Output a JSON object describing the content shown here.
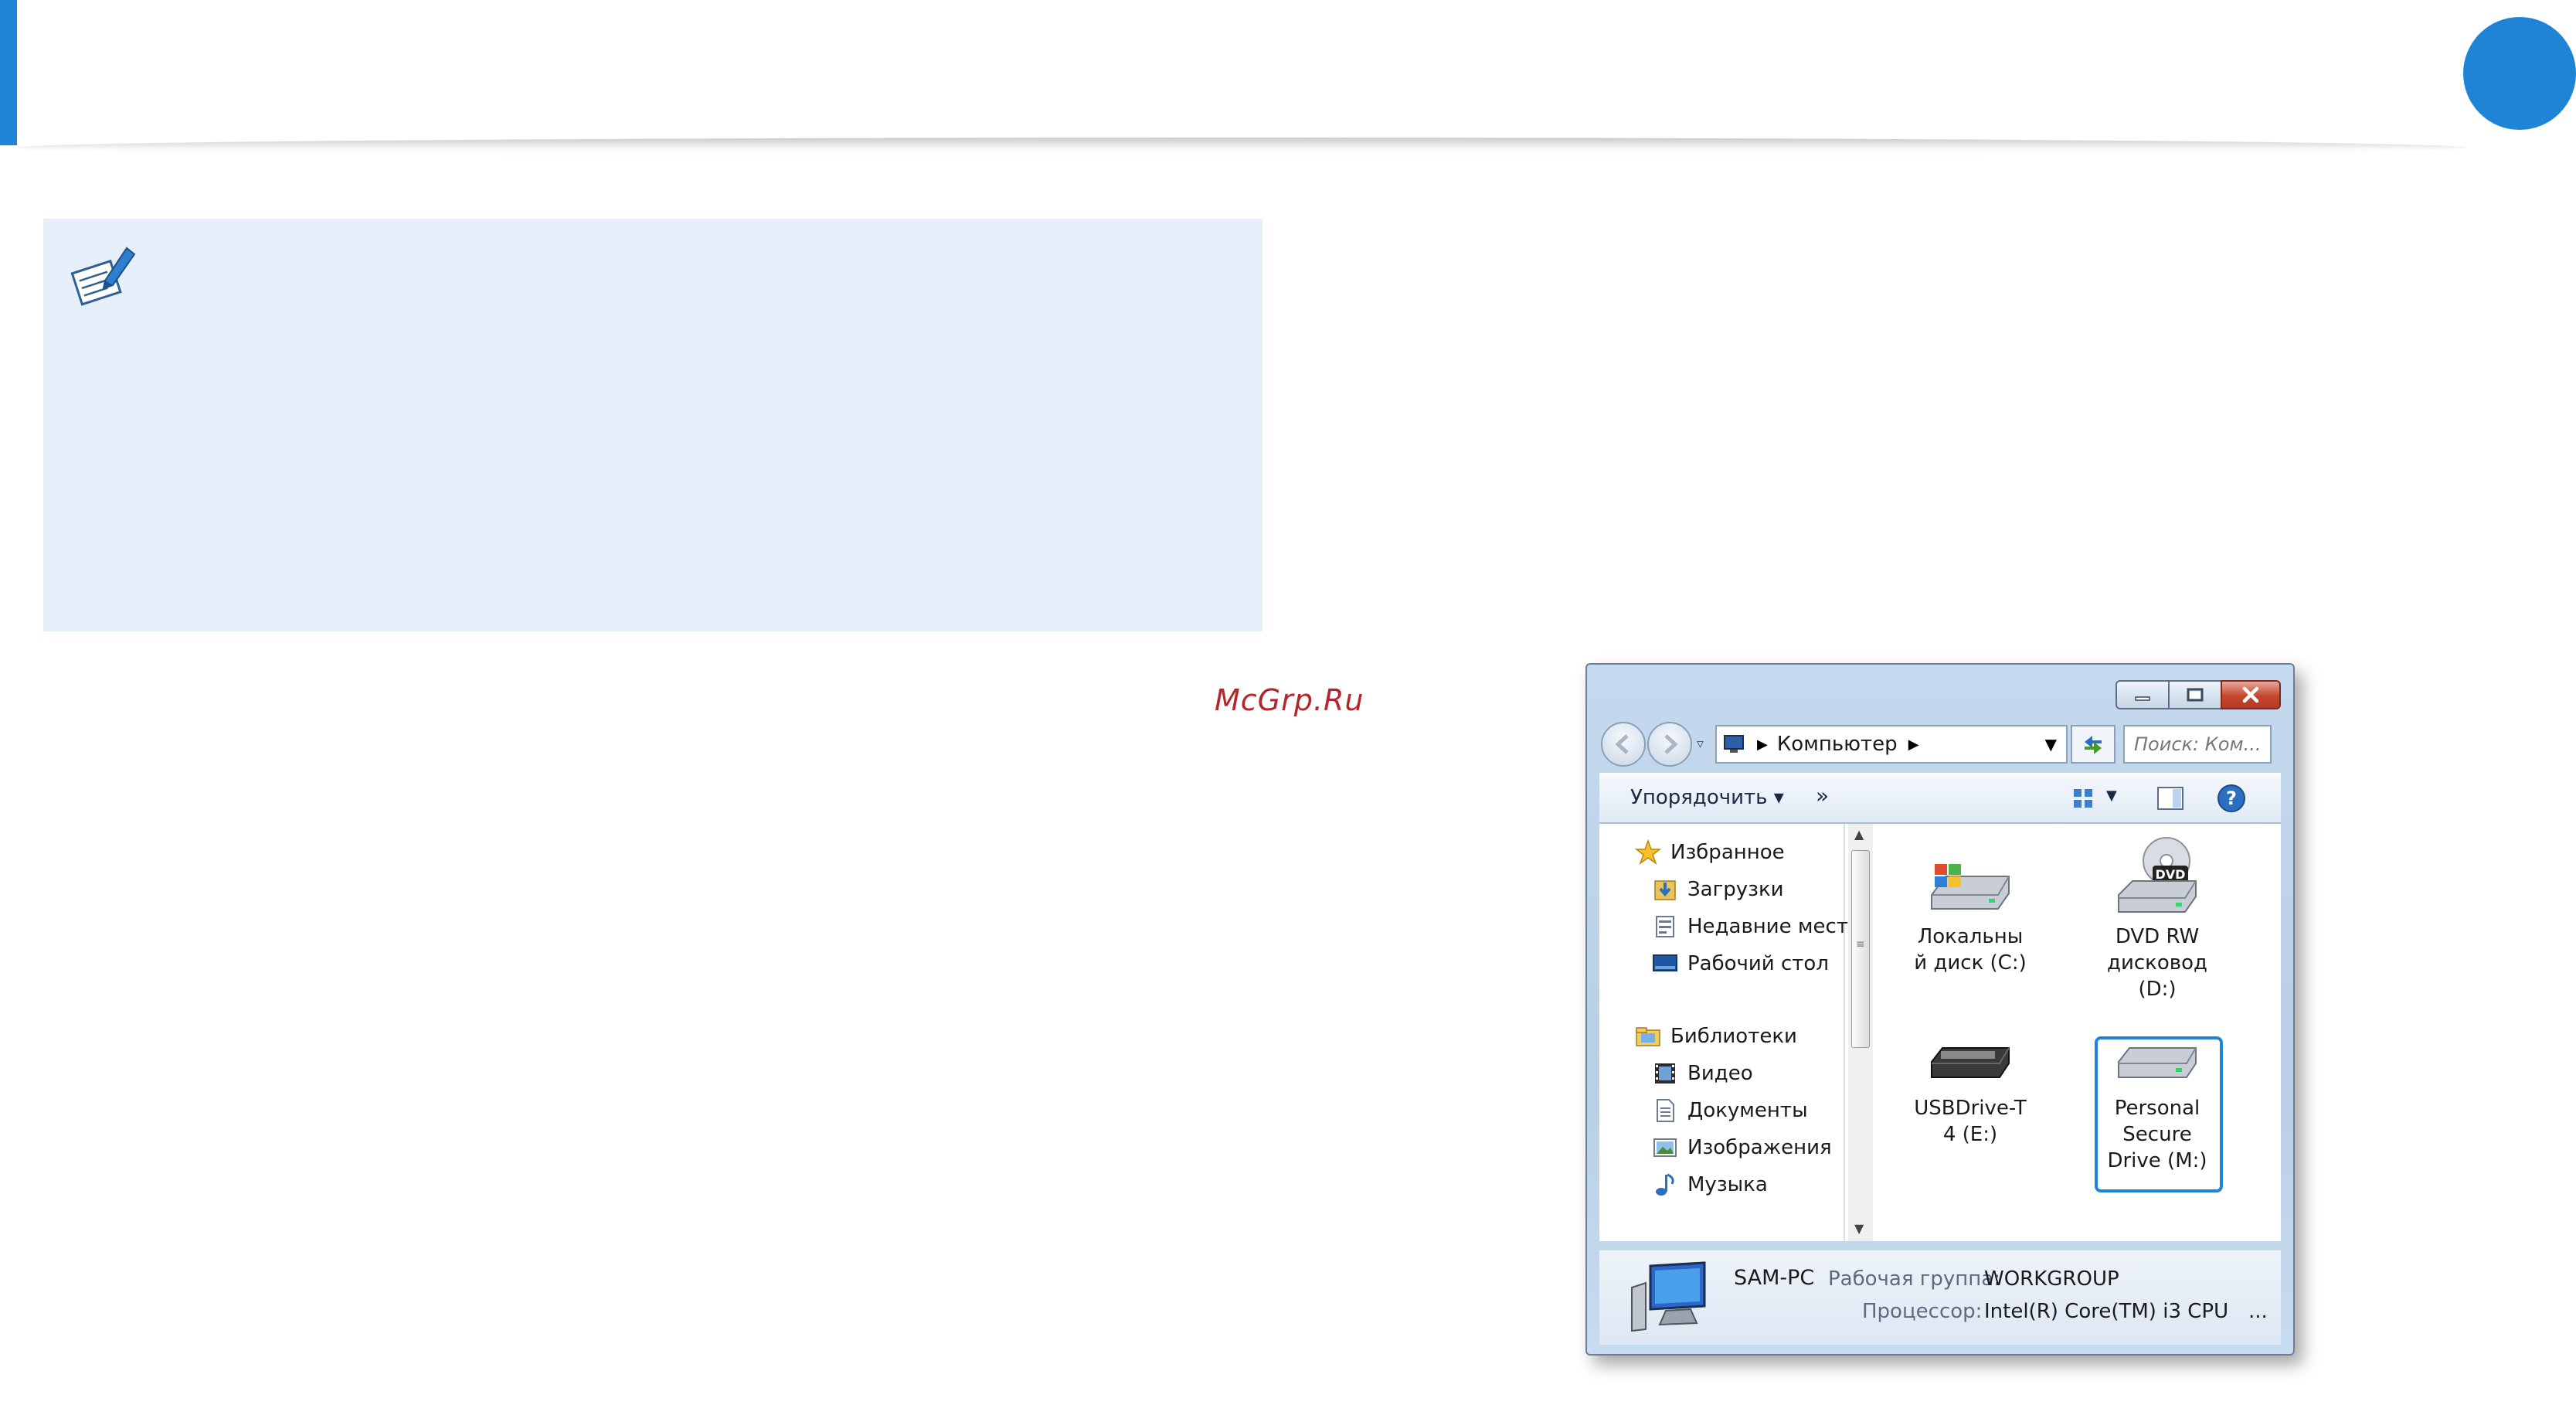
{
  "watermark": "McGrp.Ru",
  "colors": {
    "accent": "#1f84d6",
    "note_bg": "#e5f0fa",
    "watermark": "#b3262d"
  },
  "explorer": {
    "address": {
      "path": "Компьютер"
    },
    "search": {
      "placeholder": "Поиск: Ком..."
    },
    "toolbar": {
      "organize_label": "Упорядочить ▾",
      "more_label": "»"
    },
    "nav": {
      "favorites": {
        "label": "Избранное",
        "icon": "star-icon"
      },
      "favorites_items": [
        {
          "label": "Загрузки",
          "icon": "downloads-icon"
        },
        {
          "label": "Недавние места",
          "icon": "recent-places-icon"
        },
        {
          "label": "Рабочий стол",
          "icon": "desktop-icon"
        }
      ],
      "libraries": {
        "label": "Библиотеки",
        "icon": "libraries-icon"
      },
      "libraries_items": [
        {
          "label": "Видео",
          "icon": "video-icon"
        },
        {
          "label": "Документы",
          "icon": "documents-icon"
        },
        {
          "label": "Изображения",
          "icon": "images-icon"
        },
        {
          "label": "Музыка",
          "icon": "music-icon"
        }
      ]
    },
    "drives": [
      {
        "line1": "Локальны",
        "line2": "й диск (C:)",
        "line3": "",
        "icon": "local-disk-icon"
      },
      {
        "line1": "DVD RW",
        "line2": "дисковод",
        "line3": "(D:)",
        "icon": "dvd-drive-icon",
        "badge": "DVD"
      },
      {
        "line1": "USBDrive-T",
        "line2": "4 (E:)",
        "line3": "",
        "icon": "usb-drive-icon"
      },
      {
        "line1": "Personal",
        "line2": "Secure",
        "line3": "Drive (M:)",
        "icon": "secure-drive-icon",
        "selected": true
      }
    ],
    "details": {
      "name": "SAM-PC",
      "workgroup_label": "Рабочая группа:",
      "workgroup_value": "WORKGROUP",
      "cpu_label": "Процессор:",
      "cpu_value": "Intel(R) Core(TM) i3 CPU",
      "more": "..."
    }
  }
}
